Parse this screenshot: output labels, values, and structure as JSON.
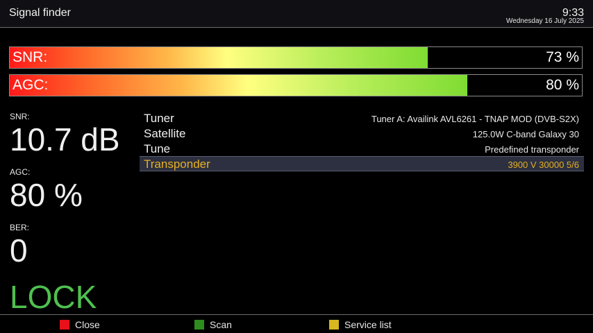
{
  "header": {
    "title": "Signal finder",
    "time": "9:33",
    "date": "Wednesday 16 July 2025"
  },
  "bars": {
    "snr": {
      "label": "SNR:",
      "value_text": "73 %",
      "level_percent": 73
    },
    "agc": {
      "label": "AGC:",
      "value_text": "80 %",
      "level_percent": 80
    }
  },
  "metrics": {
    "snr": {
      "label": "SNR:",
      "value": "10.7 dB"
    },
    "agc": {
      "label": "AGC:",
      "value": "80 %"
    },
    "ber": {
      "label": "BER:",
      "value": "0"
    },
    "status": "LOCK"
  },
  "info": [
    {
      "key": "Tuner",
      "value": "Tuner A: Availink AVL6261 - TNAP MOD (DVB-S2X)",
      "selected": false
    },
    {
      "key": "Satellite",
      "value": "125.0W C-band Galaxy 30",
      "selected": false
    },
    {
      "key": "Tune",
      "value": "Predefined transponder",
      "selected": false
    },
    {
      "key": "Transponder",
      "value": "3900 V 30000 5/6",
      "selected": true
    }
  ],
  "footer": {
    "buttons": [
      {
        "label": "Close",
        "color": "#e8101a",
        "key_icon": "red-key-icon"
      },
      {
        "label": "Scan",
        "color": "#2e8b1e",
        "key_icon": "green-key-icon"
      },
      {
        "label": "Service list",
        "color": "#d8b820",
        "key_icon": "yellow-key-icon"
      }
    ]
  },
  "colors": {
    "lock": "#4fc050",
    "selected_text": "#e8b020",
    "selected_bg": "#2c3040"
  }
}
